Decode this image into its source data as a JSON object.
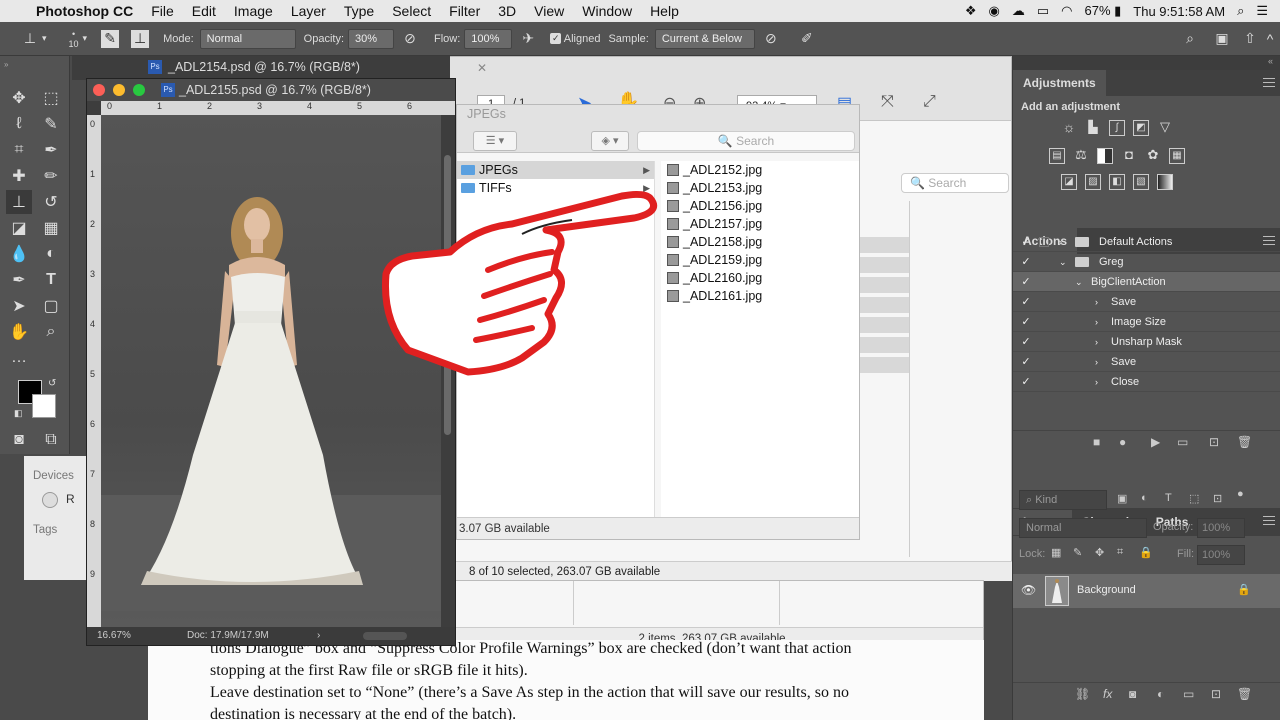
{
  "menubar": {
    "apple": "",
    "app": "Photoshop CC",
    "items": [
      "File",
      "Edit",
      "Image",
      "Layer",
      "Type",
      "Select",
      "Filter",
      "3D",
      "View",
      "Window",
      "Help"
    ],
    "battery": "67%",
    "clock": "Thu 9:51:58 AM"
  },
  "options": {
    "brush_size": "10",
    "mode_label": "Mode:",
    "mode_value": "Normal",
    "opacity_label": "Opacity:",
    "opacity_value": "30%",
    "flow_label": "Flow:",
    "flow_value": "100%",
    "aligned_label": "Aligned",
    "sample_label": "Sample:",
    "sample_value": "Current & Below"
  },
  "doc_windows": {
    "back_title": "_ADL2154.psd @ 16.7% (RGB/8*)",
    "front_title": "_ADL2155.psd @ 16.7% (RGB/8*)",
    "zoom": "16.67%",
    "doc_size": "Doc: 17.9M/17.9M",
    "ruler_h": [
      "0",
      "1",
      "2",
      "3",
      "4",
      "5",
      "6"
    ],
    "ruler_v": [
      "0",
      "1",
      "2",
      "3",
      "4",
      "5",
      "6",
      "7",
      "8",
      "9"
    ]
  },
  "finder_back": {
    "page_num": "1",
    "page_total": "/ 1",
    "zoom": "92.4%",
    "search_placeholder": "Search",
    "status": "8 of 10 selected, 263.07 GB available",
    "status2": "2 items, 263.07 GB available"
  },
  "finder_front": {
    "title": "JPEGs",
    "search_placeholder": "Search",
    "folders": [
      "JPEGs",
      "TIFFs"
    ],
    "files": [
      "_ADL2152.jpg",
      "_ADL2153.jpg",
      "_ADL2156.jpg",
      "_ADL2157.jpg",
      "_ADL2158.jpg",
      "_ADL2159.jpg",
      "_ADL2160.jpg",
      "_ADL2161.jpg"
    ],
    "status": "3.07 GB available"
  },
  "sidebar_remnants": {
    "devices": "Devices",
    "tags": "Tags",
    "device_initial": "R"
  },
  "word_doc": {
    "line1": "tions Dialogue” box and “Suppress Color Profile Warnings” box are checked (don’t want that action",
    "line2": "stopping at the first Raw file or sRGB file it hits).",
    "line3": "Leave destination set to “None” (there’s a Save As step in the action that will save our results, so no",
    "line4": "destination is necessary at the end of the batch)."
  },
  "adjustments": {
    "tab": "Adjustments",
    "heading": "Add an adjustment"
  },
  "actions": {
    "tab": "Actions",
    "rows": [
      {
        "label": "Default Actions",
        "type": "set"
      },
      {
        "label": "Greg",
        "type": "set"
      },
      {
        "label": "BigClientAction",
        "type": "action"
      },
      {
        "label": "Save",
        "type": "step"
      },
      {
        "label": "Image Size",
        "type": "step"
      },
      {
        "label": "Unsharp Mask",
        "type": "step"
      },
      {
        "label": "Save",
        "type": "step"
      },
      {
        "label": "Close",
        "type": "step"
      }
    ]
  },
  "layers": {
    "tabs": [
      "Layers",
      "Channels",
      "Paths"
    ],
    "kind": "Kind",
    "blend": "Normal",
    "opacity_label": "Opacity:",
    "opacity_value": "100%",
    "lock_label": "Lock:",
    "fill_label": "Fill:",
    "fill_value": "100%",
    "layer_name": "Background"
  },
  "colors": {
    "accent_red": "#e02020",
    "finder_blue": "#5aa0e0",
    "panel_bg": "#535353"
  }
}
